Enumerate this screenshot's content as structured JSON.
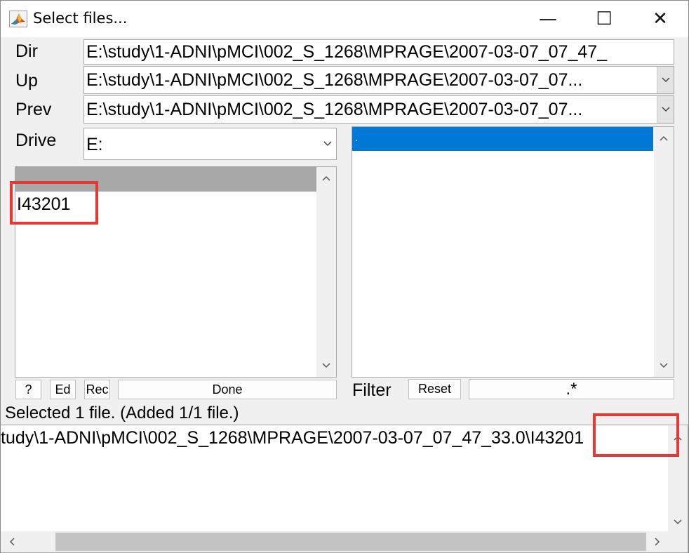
{
  "window": {
    "title": "Select files...",
    "controls": {
      "minimize": "—",
      "maximize": "☐",
      "close": "✕"
    }
  },
  "fields": {
    "dir_label": "Dir",
    "dir_value": "E:\\study\\1-ADNI\\pMCI\\002_S_1268\\MPRAGE\\2007-03-07_07_47_",
    "up_label": "Up",
    "up_value": "E:\\study\\1-ADNI\\pMCI\\002_S_1268\\MPRAGE\\2007-03-07_07...",
    "prev_label": "Prev",
    "prev_value": "E:\\study\\1-ADNI\\pMCI\\002_S_1268\\MPRAGE\\2007-03-07_07...",
    "drive_label": "Drive",
    "drive_value": "E:"
  },
  "dir_list": {
    "items": [
      "",
      "I43201"
    ]
  },
  "file_list": {
    "items": [
      "."
    ]
  },
  "buttons": {
    "help": "?",
    "ed": "Ed",
    "rec": "Rec",
    "done": "Done",
    "reset": "Reset"
  },
  "filter": {
    "label": "Filter",
    "value": ".*"
  },
  "status": {
    "text": "Selected 1 file. (Added 1/1 file.)"
  },
  "selected": {
    "path": "tudy\\1-ADNI\\pMCI\\002_S_1268\\MPRAGE\\2007-03-07_07_47_33.0\\I43201"
  },
  "colors": {
    "selection": "#0078d7",
    "header_gray": "#a8a8a8",
    "annotation_red": "#e53935"
  },
  "icons": {
    "app": "matlab-icon",
    "dropdown": "chevron-down-icon",
    "scroll_up": "chevron-up-icon",
    "scroll_down": "chevron-down-icon",
    "scroll_left": "chevron-left-icon",
    "scroll_right": "chevron-right-icon"
  }
}
